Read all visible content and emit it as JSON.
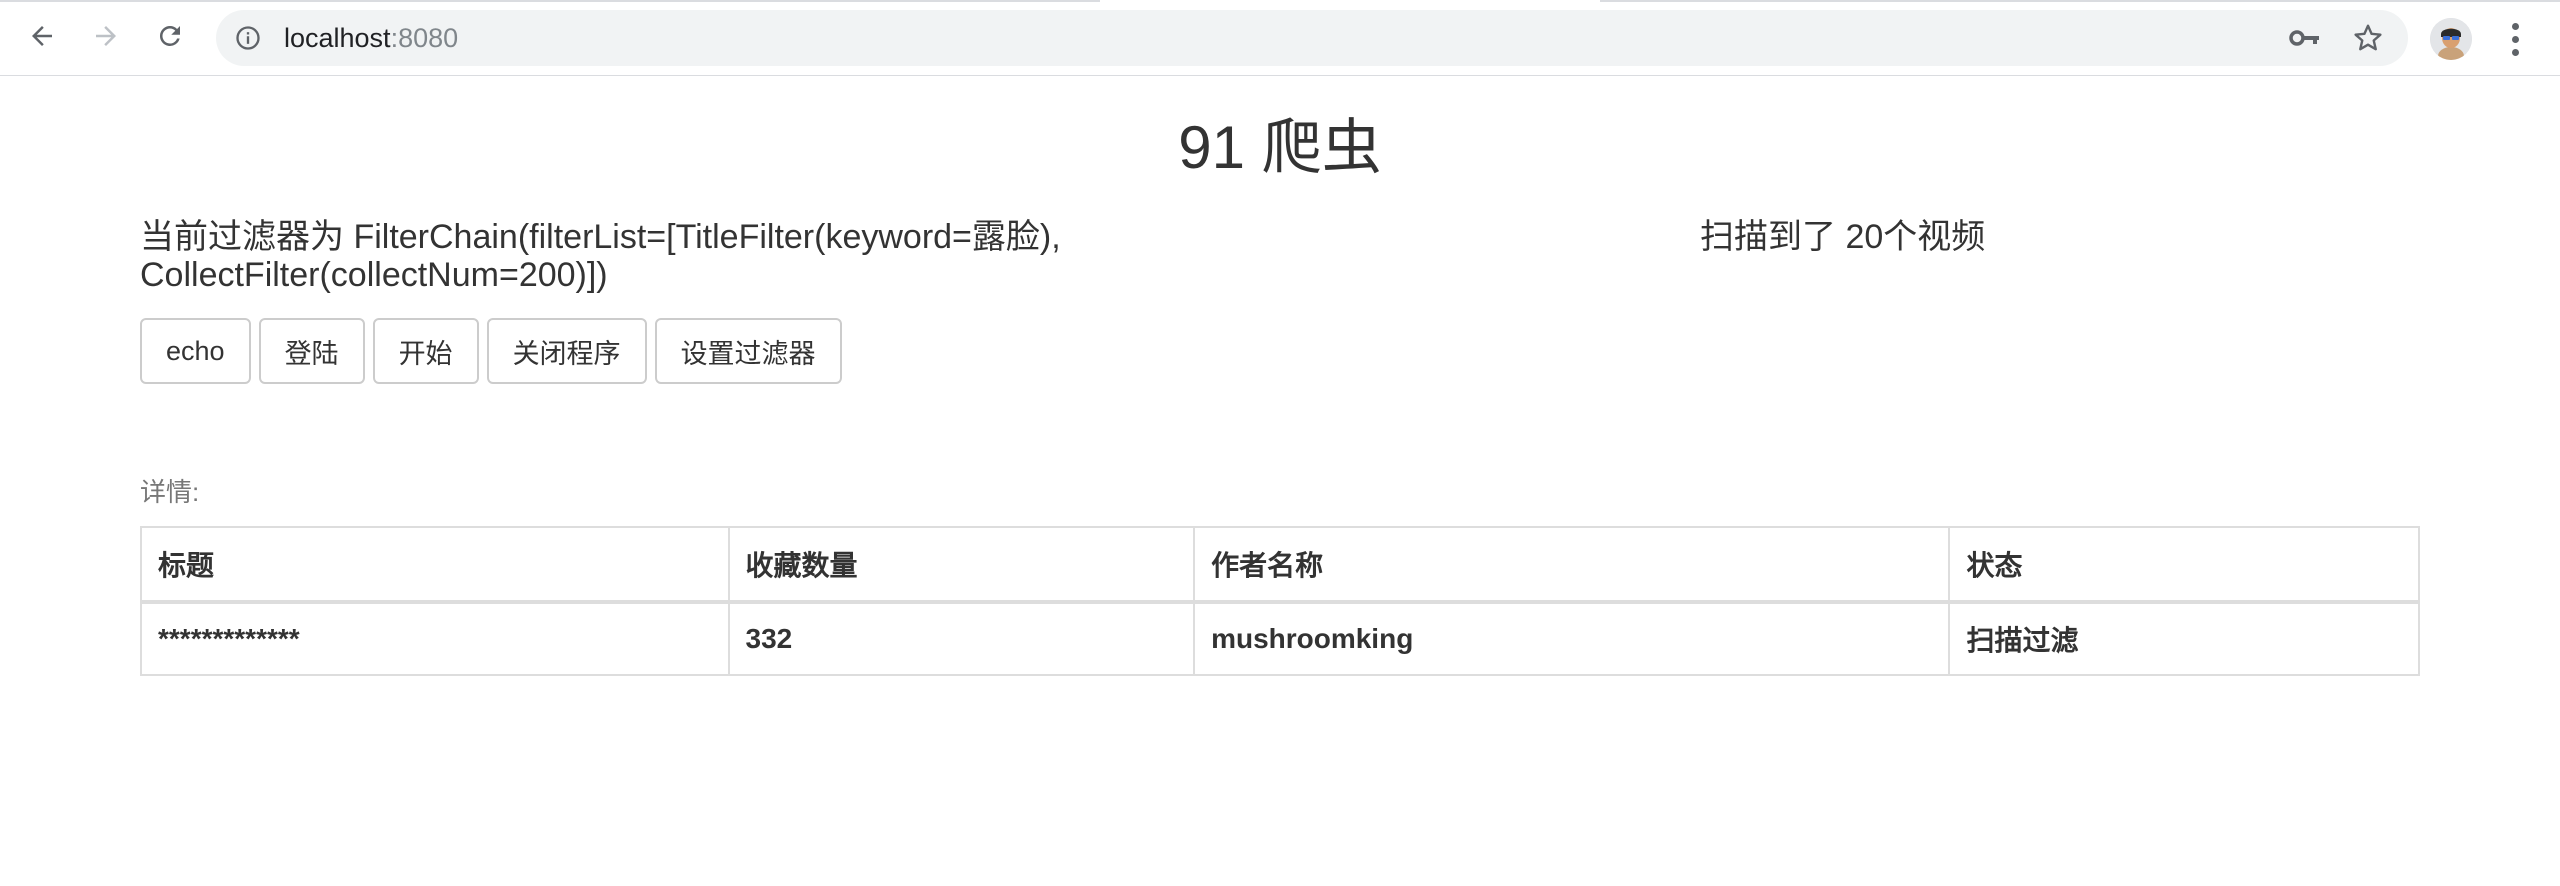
{
  "browser": {
    "url_host": "localhost",
    "url_port": ":8080"
  },
  "page": {
    "title": "91 爬虫",
    "filter_line1": "当前过滤器为 FilterChain(filterList=[TitleFilter(keyword=露脸),",
    "filter_line2": "CollectFilter(collectNum=200)])",
    "scan_status": "扫描到了 20个视频",
    "details_label": "详情:"
  },
  "buttons": {
    "echo": "echo",
    "login": "登陆",
    "start": "开始",
    "close": "关闭程序",
    "set_filter": "设置过滤器"
  },
  "table": {
    "headers": [
      "标题",
      "收藏数量",
      "作者名称",
      "状态"
    ],
    "rows": [
      [
        "*************",
        "332",
        "mushroomking",
        "扫描过滤"
      ]
    ]
  }
}
